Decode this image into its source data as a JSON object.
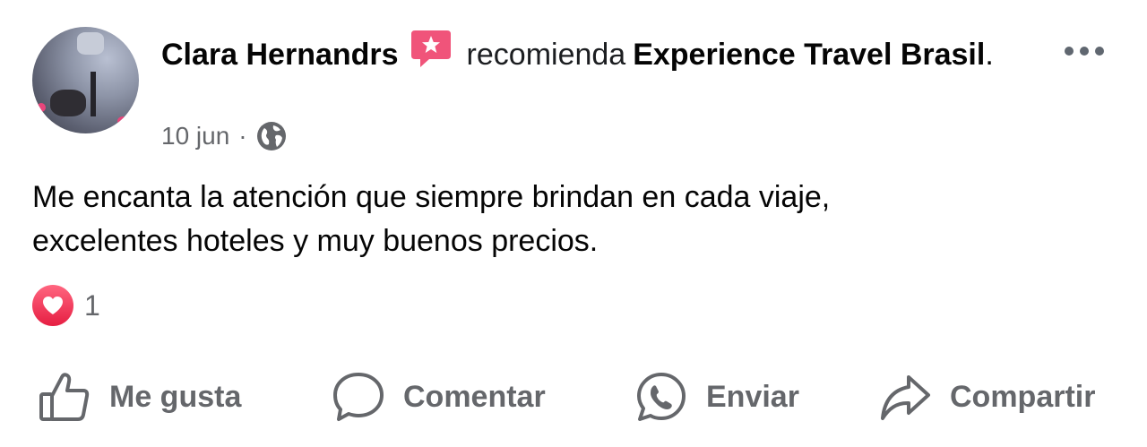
{
  "post": {
    "author": "Clara Hernandrs",
    "verb": "recomienda",
    "page_name": "Experience Travel Brasil",
    "page_suffix": ".",
    "date": "10 jun",
    "separator": "·",
    "privacy_icon": "globe-icon",
    "recommend_icon": "recommend-star-icon",
    "text_line1": "Me encanta la atención que siempre brindan en cada viaje,",
    "text_line2": "excelentes hoteles y muy buenos precios."
  },
  "reactions": {
    "icon": "heart-icon",
    "count": "1"
  },
  "actions": {
    "like": "Me gusta",
    "comment": "Comentar",
    "send": "Enviar",
    "share": "Compartir"
  },
  "colors": {
    "text": "#050505",
    "secondary": "#65676b",
    "recommend_badge": "#f0547a",
    "heart": "#f33e58"
  }
}
